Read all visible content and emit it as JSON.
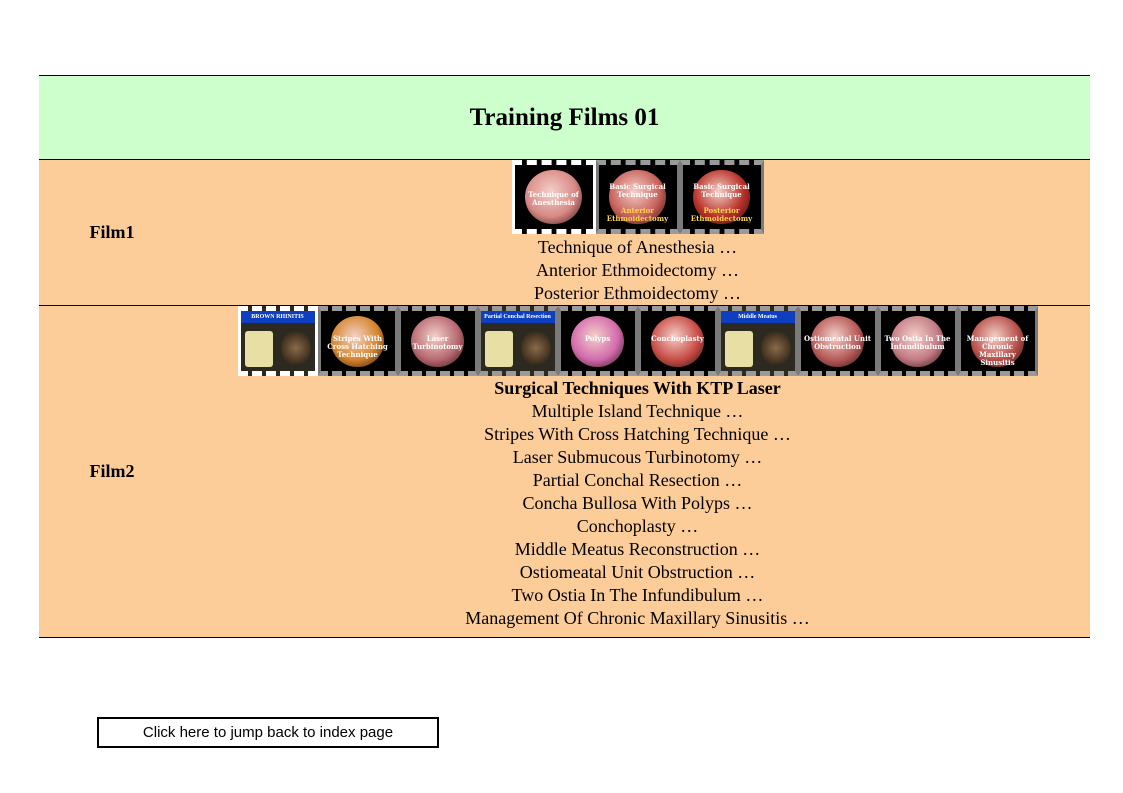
{
  "title": "Training Films 01",
  "rows": [
    {
      "label": "Film1",
      "thumbnails": [
        {
          "icon": "endoscopy-thumbnail",
          "caption": "Technique of Anesthesia",
          "color": "#d88a86",
          "selected": true
        },
        {
          "icon": "endoscopy-thumbnail",
          "caption_top": "Basic Surgical Technique",
          "caption_low": "Anterior Ethmoidectomy",
          "color": "#c9625c"
        },
        {
          "icon": "endoscopy-thumbnail",
          "caption_top": "Basic Surgical Technique",
          "caption_low": "Posterior Ethmoidectomy",
          "color": "#b8322a"
        }
      ],
      "items": [
        "Technique of Anesthesia …",
        "Anterior Ethmoidectomy …",
        "Posterior Ethmoidectomy …"
      ]
    },
    {
      "label": "Film2",
      "subheading": "Surgical Techniques With KTP Laser",
      "thumbnails": [
        {
          "icon": "xray-thumbnail",
          "bar": "BROWN RHINITIS",
          "color": "#2c2a20",
          "selected": true
        },
        {
          "icon": "endoscopy-thumbnail",
          "caption": "Stripes With Cross Hatching Technique",
          "color": "#d5862e"
        },
        {
          "icon": "endoscopy-thumbnail",
          "caption": "Laser Turbinotomy",
          "color": "#b86a72"
        },
        {
          "icon": "xray-thumbnail",
          "bar": "Partial Conchal Resection",
          "color": "#2c2a20"
        },
        {
          "icon": "endoscopy-thumbnail",
          "caption": "Polyps",
          "color": "#d36cae"
        },
        {
          "icon": "endoscopy-thumbnail",
          "caption": "Conchoplasty",
          "color": "#c94e48"
        },
        {
          "icon": "xray-thumbnail",
          "bar": "Middle Meatus",
          "color": "#2c2a20"
        },
        {
          "icon": "endoscopy-thumbnail",
          "caption": "Ostiomeatal Unit Obstruction",
          "color": "#b85c5a"
        },
        {
          "icon": "endoscopy-thumbnail",
          "caption": "Two Ostia In The Infundibulum",
          "color": "#c47c86"
        },
        {
          "icon": "endoscopy-thumbnail",
          "caption": "Management of Chronic Maxillary Sinusitis",
          "color": "#b8524c"
        }
      ],
      "items": [
        "Multiple Island Technique …",
        "Stripes With Cross Hatching Technique …",
        "Laser Submucous Turbinotomy …",
        "Partial Conchal Resection …",
        "Concha Bullosa With Polyps …",
        "Conchoplasty …",
        "Middle Meatus Reconstruction …",
        "Ostiomeatal Unit Obstruction …",
        "Two Ostia In The Infundibulum …",
        "Management Of Chronic Maxillary Sinusitis …"
      ]
    }
  ],
  "index_button": "Click here to jump back to index page",
  "colors": {
    "title_bg": "#ccffcc",
    "row_bg": "#fccc99"
  }
}
